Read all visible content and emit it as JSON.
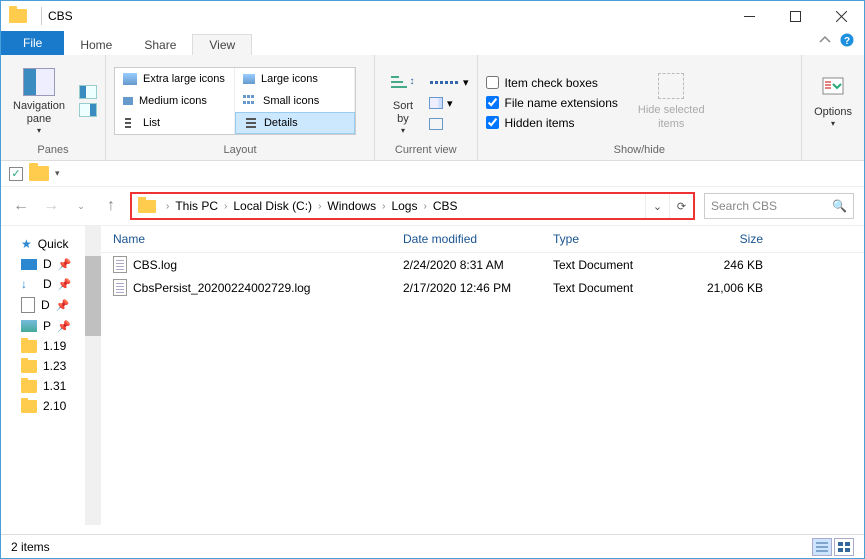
{
  "window": {
    "title": "CBS"
  },
  "tabs": {
    "file": "File",
    "home": "Home",
    "share": "Share",
    "view": "View"
  },
  "ribbon": {
    "panes": {
      "label": "Panes",
      "navpane": "Navigation\npane"
    },
    "layout": {
      "label": "Layout",
      "xl": "Extra large icons",
      "lg": "Large icons",
      "md": "Medium icons",
      "sm": "Small icons",
      "list": "List",
      "details": "Details"
    },
    "curview": {
      "label": "Current view",
      "sort": "Sort\nby"
    },
    "showhide": {
      "label": "Show/hide",
      "checkboxes": "Item check boxes",
      "ext": "File name extensions",
      "hidden": "Hidden items",
      "hidesel": "Hide selected\nitems"
    },
    "options": "Options"
  },
  "breadcrumb": [
    "This PC",
    "Local Disk (C:)",
    "Windows",
    "Logs",
    "CBS"
  ],
  "search": {
    "placeholder": "Search CBS"
  },
  "columns": {
    "name": "Name",
    "date": "Date modified",
    "type": "Type",
    "size": "Size"
  },
  "nav": {
    "quick": "Quick",
    "items": [
      {
        "label": "D"
      },
      {
        "label": "D"
      },
      {
        "label": "D"
      },
      {
        "label": "P"
      },
      {
        "label": "1.19"
      },
      {
        "label": "1.23"
      },
      {
        "label": "1.31"
      },
      {
        "label": "2.10"
      }
    ]
  },
  "files": [
    {
      "name": "CBS.log",
      "date": "2/24/2020 8:31 AM",
      "type": "Text Document",
      "size": "246 KB"
    },
    {
      "name": "CbsPersist_20200224002729.log",
      "date": "2/17/2020 12:46 PM",
      "type": "Text Document",
      "size": "21,006 KB"
    }
  ],
  "status": {
    "text": "2 items"
  }
}
